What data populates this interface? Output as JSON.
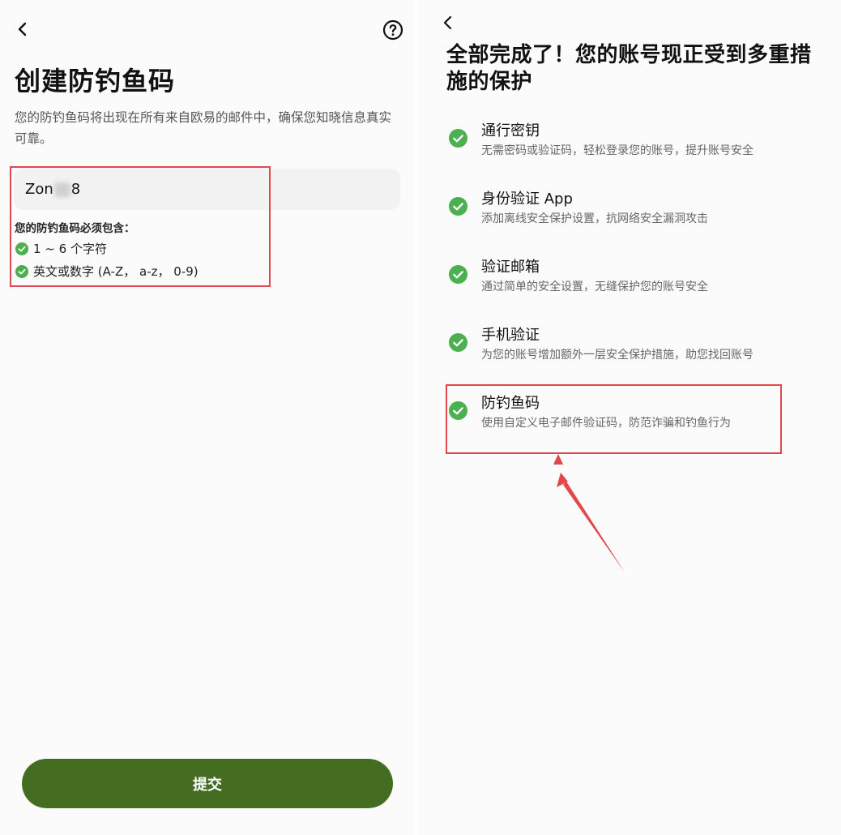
{
  "left_screen": {
    "title": "创建防钓鱼码",
    "description": "您的防钓鱼码将出现在所有来自欧易的邮件中，确保您知晓信息真实可靠。",
    "code_input": {
      "value_prefix": "Zon",
      "value_suffix": "8"
    },
    "requirements": {
      "title": "您的防钓鱼码必须包含：",
      "items": [
        {
          "label": "1 ~ 6 个字符",
          "met": true
        },
        {
          "label": "英文或数字 (A-Z， a-z， 0-9)",
          "met": true
        }
      ]
    },
    "submit_label": "提交"
  },
  "right_screen": {
    "title": "全部完成了！您的账号现正受到多重措施的保护",
    "items": [
      {
        "name": "通行密钥",
        "description": "无需密码或验证码，轻松登录您的账号，提升账号安全",
        "enabled": true
      },
      {
        "name": "身份验证 App",
        "description": "添加离线安全保护设置，抗网络安全漏洞攻击",
        "enabled": true
      },
      {
        "name": "验证邮箱",
        "description": "通过简单的安全设置，无缝保护您的账号安全",
        "enabled": true
      },
      {
        "name": "手机验证",
        "description": "为您的账号增加额外一层安全保护措施，助您找回账号",
        "enabled": true
      },
      {
        "name": "防钓鱼码",
        "description": "使用自定义电子邮件验证码，防范诈骗和钓鱼行为",
        "enabled": true
      }
    ]
  },
  "icons": {
    "back": "chevron-left-icon",
    "help": "question-circle-icon",
    "check": "check-circle-icon",
    "annotation_arrow": "red-arrow-icon"
  },
  "colors": {
    "brand_green": "#446d22",
    "check_green": "#4caf50",
    "annotation_red": "#e2474a",
    "input_bg": "#f2f2f2"
  }
}
